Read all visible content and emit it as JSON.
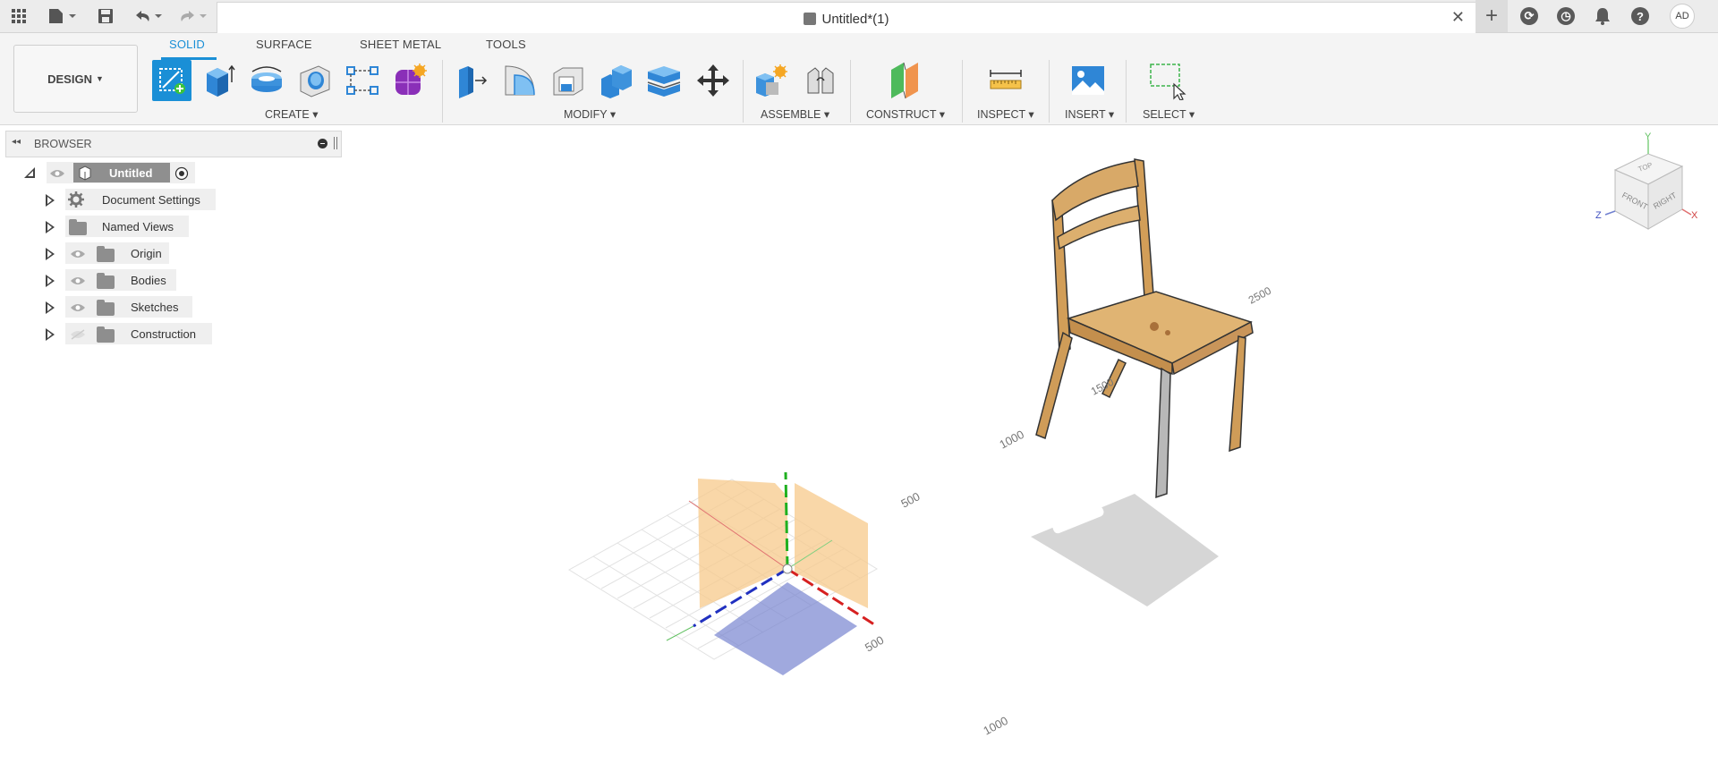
{
  "window": {
    "title": "Untitled*(1)"
  },
  "toolbar": {
    "workspace": "DESIGN",
    "tabs": [
      "SOLID",
      "SURFACE",
      "SHEET METAL",
      "TOOLS"
    ],
    "groups": {
      "create": "CREATE",
      "modify": "MODIFY",
      "assemble": "ASSEMBLE",
      "construct": "CONSTRUCT",
      "inspect": "INSPECT",
      "insert": "INSERT",
      "select": "SELECT"
    }
  },
  "user": {
    "initials": "AD"
  },
  "browser": {
    "title": "BROWSER",
    "root": "Untitled",
    "items": [
      "Document Settings",
      "Named Views",
      "Origin",
      "Bodies",
      "Sketches",
      "Construction"
    ]
  },
  "viewport": {
    "dimension_labels": [
      "500",
      "500",
      "1000",
      "1000",
      "2500",
      "1500"
    ],
    "viewcube": {
      "top": "TOP",
      "front": "FRONT",
      "right": "RIGHT",
      "x": "X",
      "y": "Y",
      "z": "Z"
    }
  },
  "colors": {
    "accent": "#1a8fd6",
    "x_axis": "#d62020",
    "y_axis": "#20b020",
    "z_axis": "#2030c0",
    "wood": "#d9a85f"
  }
}
